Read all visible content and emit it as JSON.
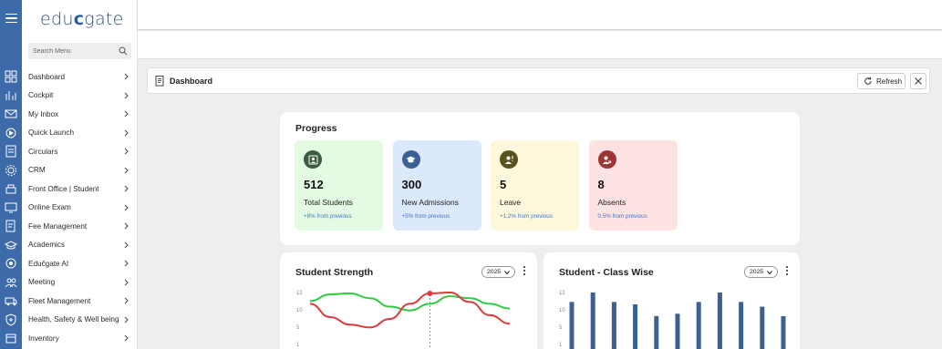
{
  "app": {
    "logo_prefix": "edu",
    "logo_mid": "c",
    "logo_suffix": "gate"
  },
  "search": {
    "placeholder": "Search Menu"
  },
  "sidebar": {
    "items": [
      {
        "label": "Dashboard",
        "icon": "dashboard-icon"
      },
      {
        "label": "Cockpit",
        "icon": "cockpit-icon"
      },
      {
        "label": "My Inbox",
        "icon": "inbox-icon"
      },
      {
        "label": "Quick Launch",
        "icon": "quick-launch-icon"
      },
      {
        "label": "Circulars",
        "icon": "circulars-icon"
      },
      {
        "label": "CRM",
        "icon": "crm-icon"
      },
      {
        "label": "Front Office | Student",
        "icon": "front-office-icon"
      },
      {
        "label": "Online Exam",
        "icon": "online-exam-icon"
      },
      {
        "label": "Fee Management",
        "icon": "fee-icon"
      },
      {
        "label": "Academics",
        "icon": "academics-icon"
      },
      {
        "label": "Eduĉgate AI",
        "icon": "ai-icon"
      },
      {
        "label": "Meeting",
        "icon": "meeting-icon"
      },
      {
        "label": "Fleet Management",
        "icon": "fleet-icon"
      },
      {
        "label": "Health, Safety & Well being",
        "icon": "health-icon"
      },
      {
        "label": "Inventory",
        "icon": "inventory-icon"
      }
    ]
  },
  "dashboard": {
    "title": "Dashboard",
    "refresh_label": "Refresh"
  },
  "progress": {
    "title": "Progress",
    "tiles": [
      {
        "value": "512",
        "label": "Total Students",
        "change": "+8% from previous",
        "bg": "#e3fbe3",
        "icon_bg": "#3b5c3f",
        "icon": "student-id-icon"
      },
      {
        "value": "300",
        "label": "New Admissions",
        "change": "+5% from previous",
        "bg": "#dce8fb",
        "icon_bg": "#3c5f94",
        "icon": "graduation-cap-icon"
      },
      {
        "value": "5",
        "label": "Leave",
        "change": "+1,2% from previous",
        "bg": "#fdf7dc",
        "icon_bg": "#58521f",
        "icon": "user-leave-icon"
      },
      {
        "value": "8",
        "label": "Absents",
        "change": "0.5% from previous",
        "bg": "#fde2e2",
        "icon_bg": "#9c3535",
        "icon": "user-absent-icon"
      }
    ]
  },
  "charts": {
    "strength": {
      "title": "Student Strength",
      "year": "2025"
    },
    "classwise": {
      "title": "Student - Class Wise",
      "year": "2025"
    }
  },
  "chart_data": [
    {
      "type": "line",
      "title": "Student Strength",
      "yticks": [
        "12",
        "10",
        "5",
        "1"
      ],
      "series": [
        {
          "color": "#2ecc40",
          "values": [
            10.2,
            11.6,
            11.8,
            10.8,
            9.0,
            8.2,
            9.6,
            11.2,
            10.8,
            9.6,
            8.6
          ]
        },
        {
          "color": "#e03a3a",
          "values": [
            9.6,
            6.8,
            5.2,
            4.6,
            6.4,
            9.6,
            11.8,
            12.0,
            10.0,
            7.2,
            5.4
          ]
        }
      ],
      "highlight_index": 6
    },
    {
      "type": "bar",
      "title": "Student - Class Wise",
      "yticks": [
        "12",
        "10",
        "5",
        "1"
      ],
      "values": [
        10,
        12,
        10,
        9.5,
        7,
        7.5,
        10,
        12,
        10,
        9,
        7
      ],
      "color": "#3c5f94"
    }
  ],
  "colors": {
    "rail": "#3d6aa8",
    "accent": "#3c5f94"
  }
}
